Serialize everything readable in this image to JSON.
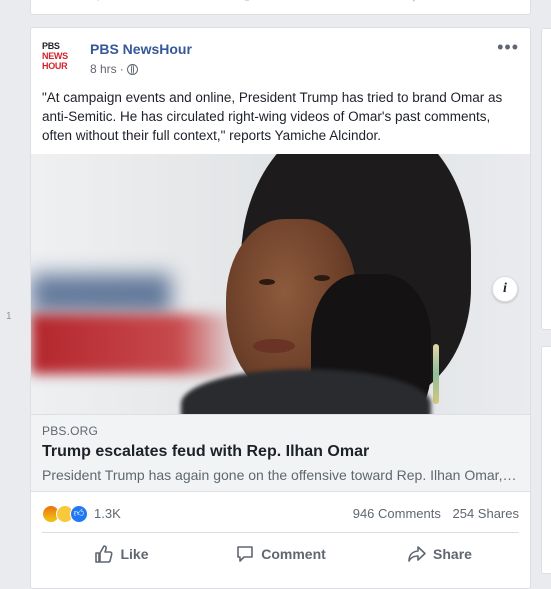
{
  "side_marker": "1",
  "post": {
    "page_name": "PBS NewsHour",
    "logo_lines": [
      "PBS",
      "NEWS",
      "HOUR"
    ],
    "time": "8 hrs",
    "separator": "·",
    "more_label": "•••",
    "text": "\"At campaign events and online, President Trump has tried to brand Omar as anti-Semitic. He has circulated right-wing videos of Omar's past comments, often without their full context,\" reports Yamiche Alcindor.",
    "info_label": "i",
    "link": {
      "domain": "PBS.ORG",
      "title": "Trump escalates feud with Rep. Ilhan Omar",
      "description": "President Trump has again gone on the offensive toward Rep. Ilhan Omar, …"
    },
    "reactions": {
      "count": "1.3K",
      "comments": "946 Comments",
      "shares": "254 Shares",
      "icons": [
        "angry-icon",
        "sad-icon",
        "like-icon"
      ]
    },
    "actions": {
      "like": "Like",
      "comment": "Comment",
      "share": "Share"
    }
  },
  "colors": {
    "page_name": "#365899",
    "background": "#e9ebee",
    "muted_text": "#606770",
    "like_blue": "#2078f4",
    "pbs_red": "#d3232b"
  }
}
